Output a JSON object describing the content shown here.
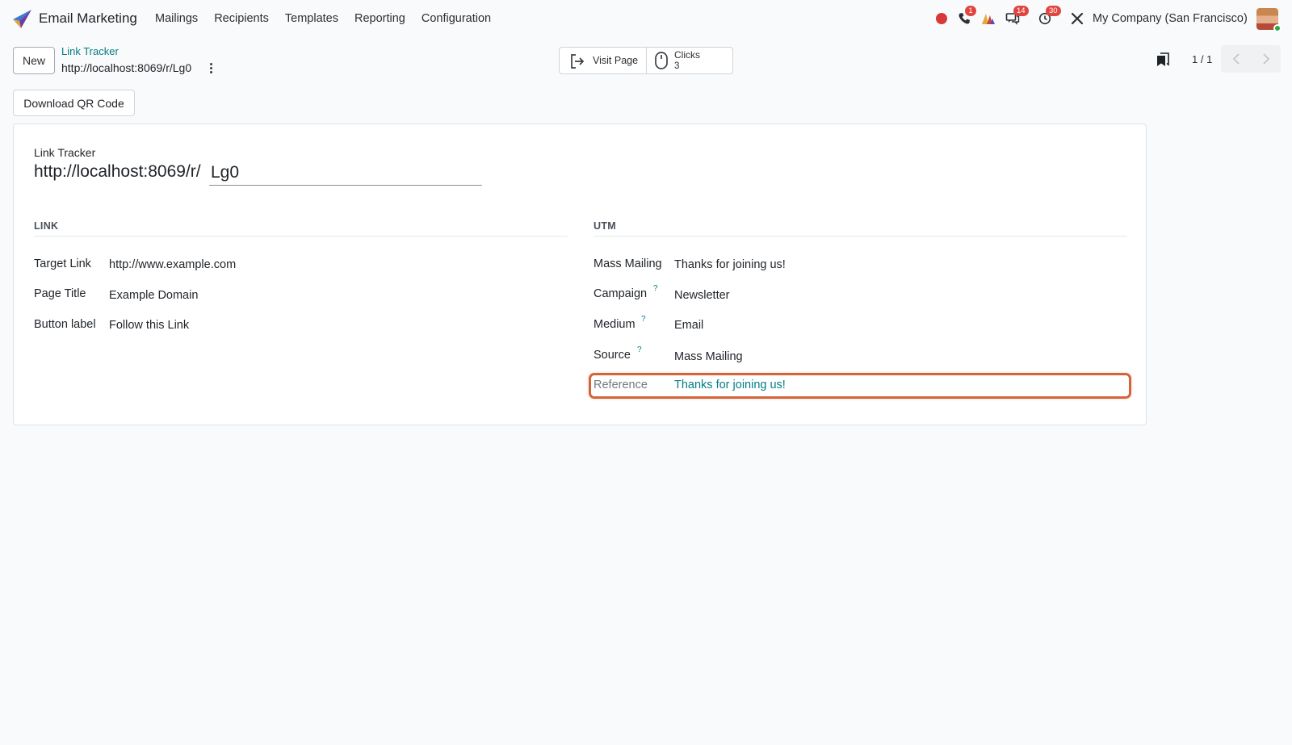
{
  "navbar": {
    "app_name": "Email Marketing",
    "menu": [
      "Mailings",
      "Recipients",
      "Templates",
      "Reporting",
      "Configuration"
    ],
    "badges": {
      "phone": "1",
      "messages": "14",
      "activities": "30"
    },
    "company": "My Company (San Francisco)",
    "record_dot_color": "#d9383a"
  },
  "control_panel": {
    "new_label": "New",
    "breadcrumb_parent": "Link Tracker",
    "breadcrumb_current": "http://localhost:8069/r/Lg0",
    "visit_page_label": "Visit Page",
    "clicks_label": "Clicks",
    "clicks_value": "3",
    "pager": "1 / 1",
    "qr_label": "Download QR Code"
  },
  "form": {
    "title_label": "Link Tracker",
    "title_prefix": "http://localhost:8069/r/",
    "title_code": "Lg0",
    "link_group": {
      "title": "LINK",
      "fields": [
        {
          "label": "Target Link",
          "value": "http://www.example.com"
        },
        {
          "label": "Page Title",
          "value": "Example Domain"
        },
        {
          "label": "Button label",
          "value": "Follow this Link"
        }
      ]
    },
    "utm_group": {
      "title": "UTM",
      "fields": [
        {
          "label": "Mass Mailing",
          "value": "Thanks for joining us!"
        },
        {
          "label": "Campaign",
          "value": "Newsletter",
          "help": "?"
        },
        {
          "label": "Medium",
          "value": "Email",
          "help": "?"
        },
        {
          "label": "Source",
          "value": "Mass Mailing",
          "help": "?"
        },
        {
          "label": "Reference",
          "value": "Thanks for joining us!"
        }
      ]
    },
    "highlight_color": "#d4653b",
    "accent_color": "#017e84"
  }
}
